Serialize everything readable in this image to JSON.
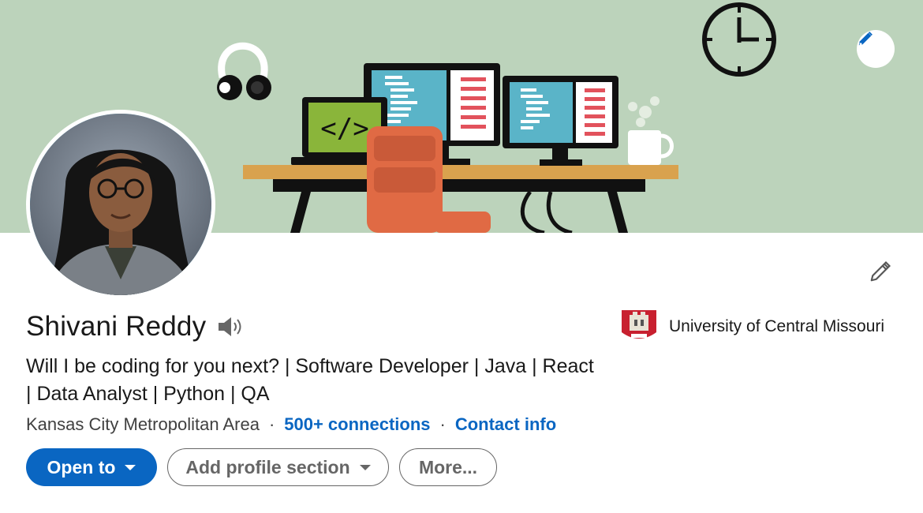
{
  "profile": {
    "name": "Shivani Reddy",
    "headline": "Will I be coding for you next? | Software Developer | Java | React | Data Analyst | Python | QA",
    "location": "Kansas City Metropolitan Area",
    "connections": "500+ connections",
    "contact_info": "Contact info",
    "separator": "·",
    "education": {
      "school": "University of Central Missouri"
    }
  },
  "actions": {
    "open_to": "Open to",
    "add_section": "Add profile section",
    "more": "More..."
  },
  "icons": {
    "banner_edit": "pencil-icon",
    "intro_edit": "pencil-icon",
    "pronunciation": "speaker-icon",
    "school_logo": "university-logo-icon"
  },
  "colors": {
    "accent": "#0a66c2",
    "banner_bg": "#bcd3bb",
    "avatar_ring": "#4fc1e9",
    "text": "#191919",
    "muted": "#666666"
  }
}
